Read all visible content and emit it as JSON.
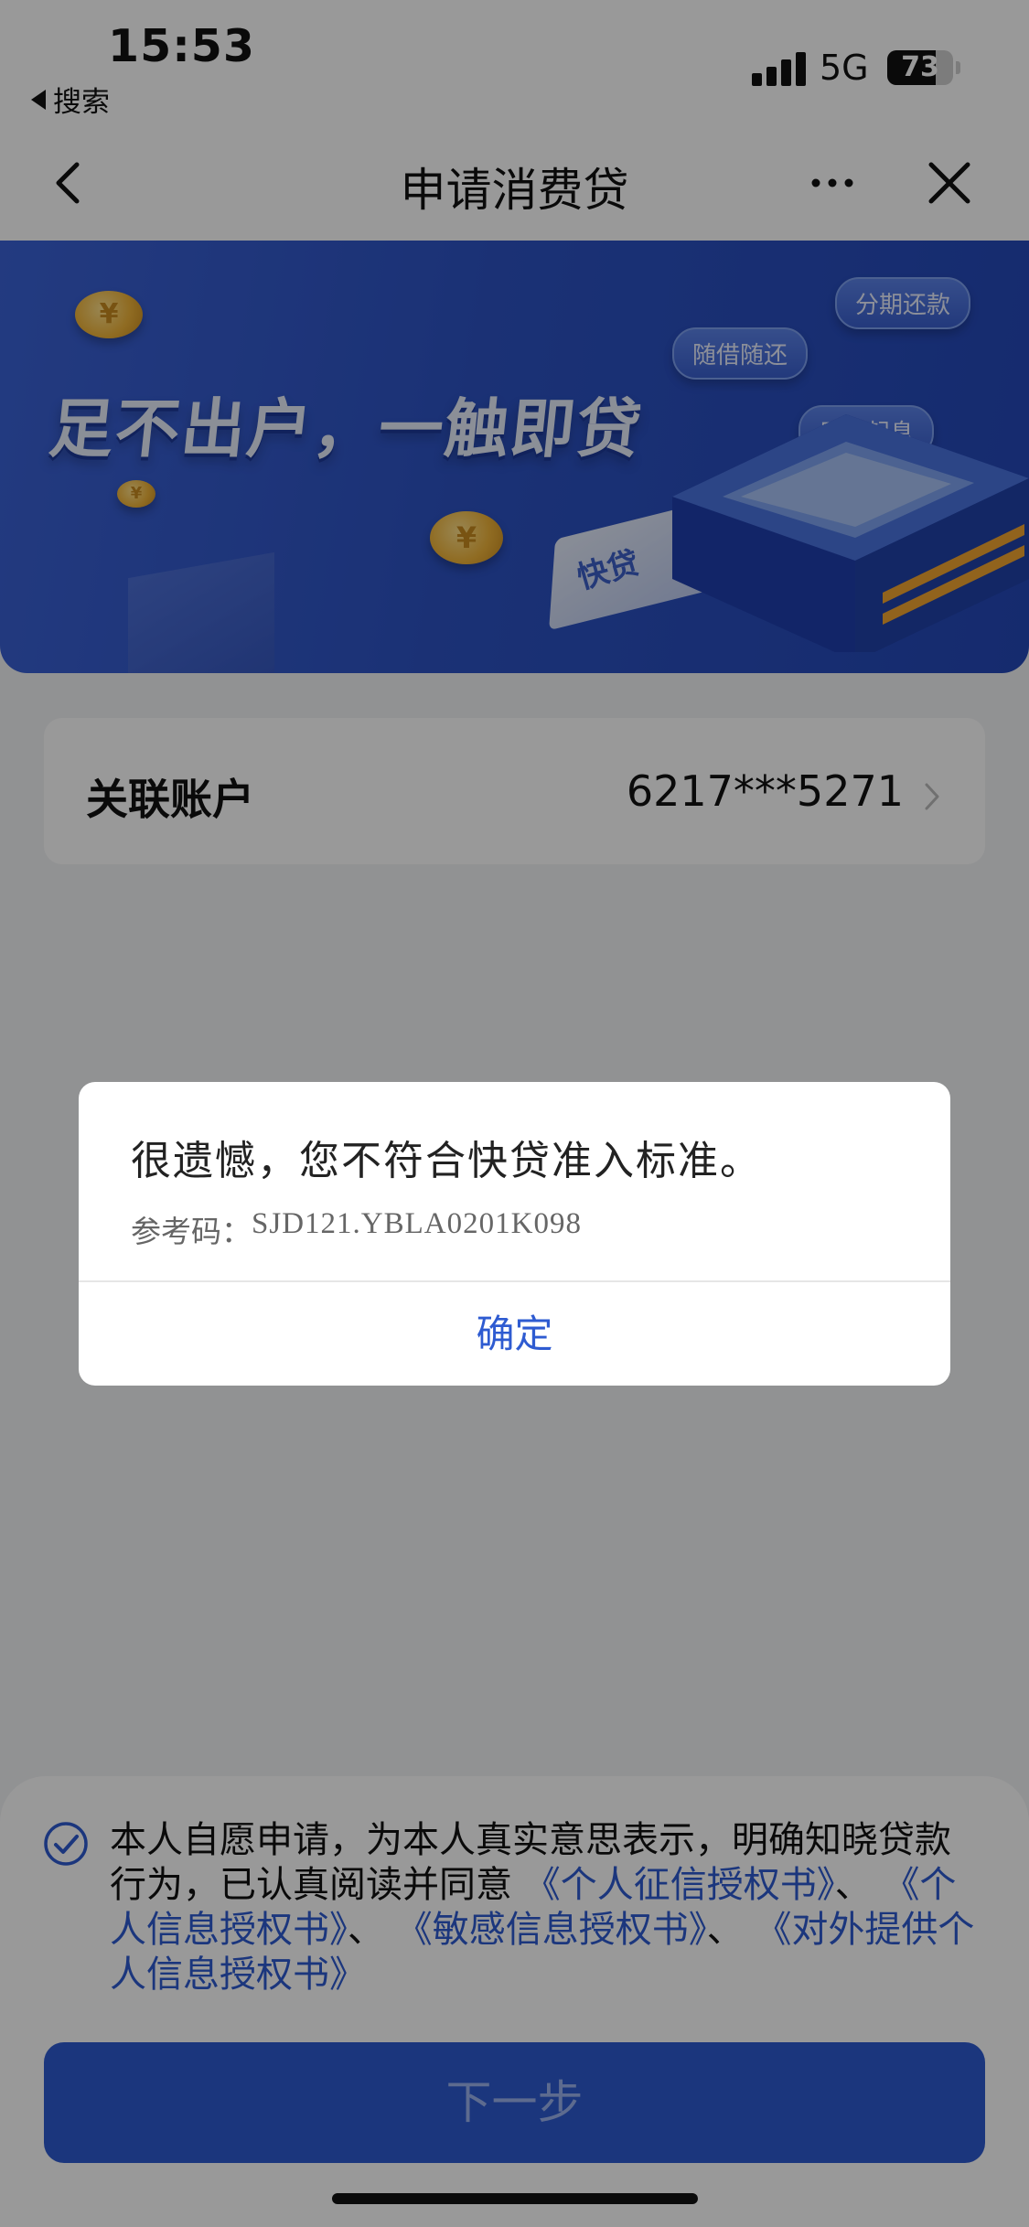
{
  "status_bar": {
    "time": "15:53",
    "back_app": "搜索",
    "network": "5G",
    "battery": "73",
    "battery_level": 0.73
  },
  "nav": {
    "title": "申请消费贷",
    "back_icon": "chevron-left-icon",
    "more_icon": "more-horizontal-icon",
    "close_icon": "close-icon"
  },
  "banner": {
    "slogan": "足不出户，一触即贷",
    "tags": [
      "分期还款",
      "随借随还",
      "用时起息"
    ],
    "card_label": "快贷"
  },
  "account": {
    "label": "关联账户",
    "value": "6217***5271"
  },
  "agreement": {
    "checked": true,
    "text_before": "本人自愿申请，为本人真实意思表示，明确知晓贷款行为，已认真阅读并同意",
    "links": [
      "《个人征信授权书》",
      "《个人信息授权书》",
      "《敏感信息授权书》",
      "《对外提供个人信息授权书》"
    ],
    "separator": "、"
  },
  "next_button": "下一步",
  "dialog": {
    "message": "很遗憾，您不符合快贷准入标准。",
    "ref_label": "参考码：",
    "ref_code": "SJD121.YBLA0201K098",
    "confirm": "确定"
  },
  "colors": {
    "accent": "#2e5bd1",
    "banner": "#2d53c4",
    "overlay": "rgba(0,0,0,0.40)"
  }
}
